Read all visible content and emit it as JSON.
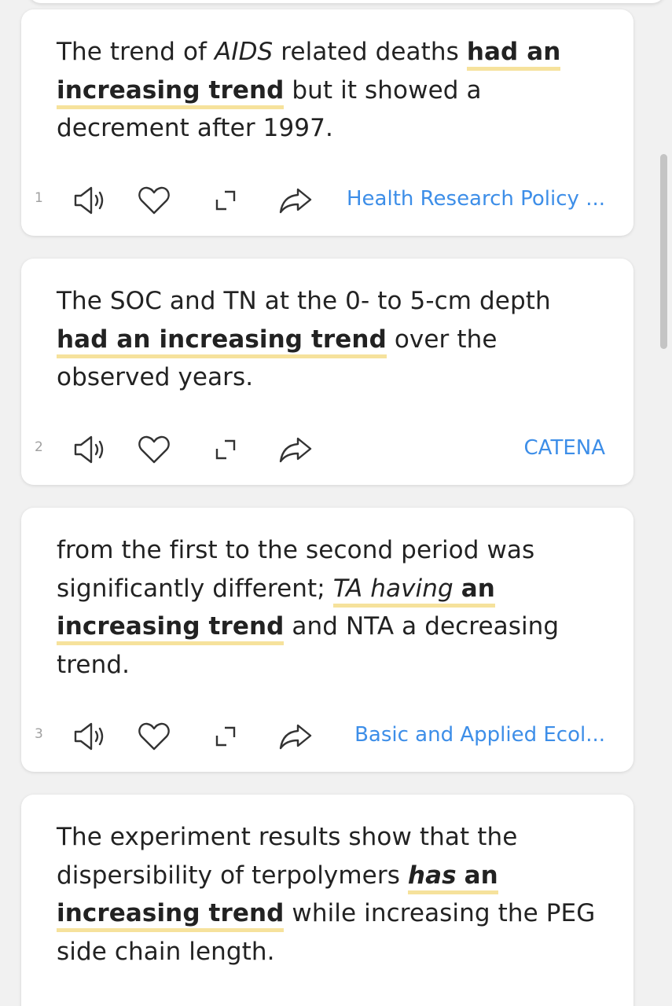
{
  "cards": [
    {
      "index": "1",
      "text": {
        "p1": "The trend of ",
        "p2": "AIDS",
        "p3": " related deaths ",
        "p4": "had an",
        "p5": "increasing trend",
        "p6": " but it showed a decrement after 1997."
      },
      "source": "Health Research Policy ..."
    },
    {
      "index": "2",
      "text": {
        "p1": "The SOC and TN at the 0- to 5-cm depth ",
        "p2": "had an increasing trend",
        "p3": " over the observed years."
      },
      "source": "CATENA"
    },
    {
      "index": "3",
      "text": {
        "p1": "from the first to the second period was significantly different; ",
        "p2": "TA having",
        "p3": " ",
        "p4": "an",
        "p5": "increasing trend",
        "p6": " and NTA a decreasing trend."
      },
      "source": "Basic and Applied Ecol..."
    },
    {
      "index": "",
      "text": {
        "p1": "The experiment results show that the dispersibility of terpolymers ",
        "p2": "has",
        "p3": " ",
        "p4": "an",
        "p5": "increasing trend",
        "p6": " while increasing the PEG side chain length."
      },
      "source": ""
    }
  ],
  "icons": {
    "speaker": "speaker-icon",
    "heart": "heart-icon",
    "expand": "expand-icon",
    "share": "share-icon"
  },
  "colors": {
    "highlight": "#f6e29c",
    "source_link": "#3d8ee8",
    "icon": "#333333",
    "background": "#f1f1f1"
  }
}
